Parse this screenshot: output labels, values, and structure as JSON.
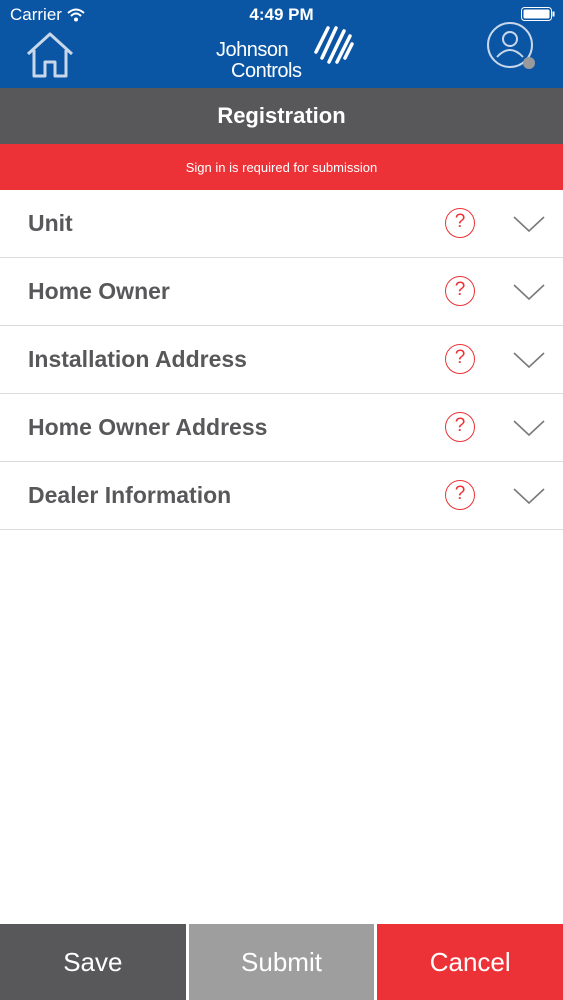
{
  "colors": {
    "brand_blue": "#0a56a5",
    "title_gray": "#58585a",
    "alert_red": "#ed3237",
    "submit_gray": "#9e9e9e"
  },
  "status_bar": {
    "carrier": "Carrier",
    "time": "4:49 PM"
  },
  "header": {
    "home_icon": "home-icon",
    "logo_line1": "Johnson",
    "logo_line2": "Controls",
    "profile_icon": "user-profile-icon"
  },
  "title": "Registration",
  "alert": "Sign in is required for submission",
  "sections": [
    {
      "label": "Unit"
    },
    {
      "label": "Home Owner"
    },
    {
      "label": "Installation Address"
    },
    {
      "label": "Home Owner Address"
    },
    {
      "label": "Dealer Information"
    }
  ],
  "help_glyph": "?",
  "buttons": {
    "save": "Save",
    "submit": "Submit",
    "cancel": "Cancel"
  }
}
